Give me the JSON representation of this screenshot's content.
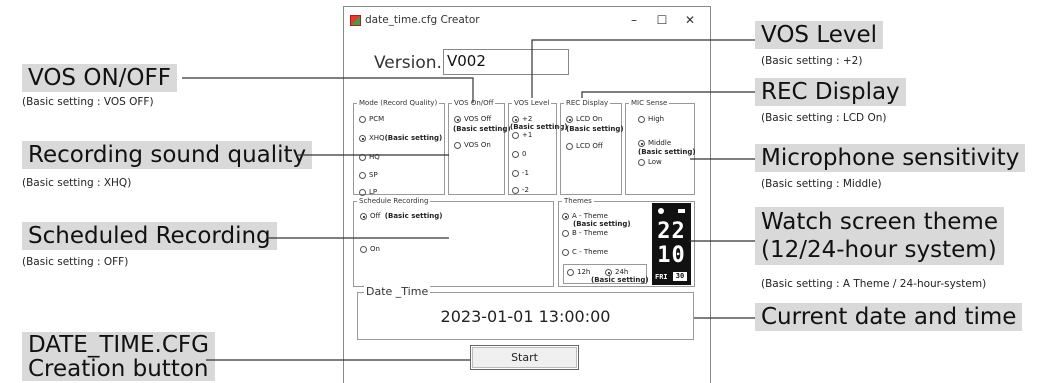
{
  "window": {
    "title": "date_time.cfg Creator",
    "controls": {
      "minimize": "–",
      "maximize": "☐",
      "close": "✕"
    }
  },
  "version": {
    "label": "Version.",
    "value": "V002"
  },
  "groups": {
    "mode": {
      "title": "Mode (Record Quality)",
      "options": [
        {
          "label": "PCM",
          "selected": false
        },
        {
          "label": "XHQ",
          "suffix": "(Basic setting)",
          "selected": true
        },
        {
          "label": "HQ",
          "selected": false
        },
        {
          "label": "SP",
          "selected": false
        },
        {
          "label": "LP",
          "selected": false
        }
      ]
    },
    "vos_onoff": {
      "title": "VOS On/Off",
      "options": [
        {
          "label": "VOS Off",
          "suffix": "(Basic setting)",
          "selected": true
        },
        {
          "label": "VOS On",
          "selected": false
        }
      ]
    },
    "vos_level": {
      "title": "VOS Level",
      "options": [
        {
          "label": "+2",
          "suffix": "(Basic setting)",
          "selected": true
        },
        {
          "label": "+1",
          "selected": false
        },
        {
          "label": "0",
          "selected": false
        },
        {
          "label": "-1",
          "selected": false
        },
        {
          "label": "-2",
          "selected": false
        }
      ]
    },
    "rec_display": {
      "title": "REC Display",
      "options": [
        {
          "label": "LCD On",
          "suffix": "(Basic setting)",
          "selected": true
        },
        {
          "label": "LCD Off",
          "selected": false
        }
      ]
    },
    "mic_sense": {
      "title": "MIC Sense",
      "options": [
        {
          "label": "High",
          "selected": false
        },
        {
          "label": "Middle",
          "suffix": "(Basic setting)",
          "selected": true
        },
        {
          "label": "Low",
          "selected": false
        }
      ]
    },
    "schedule": {
      "title": "Schedule Recording",
      "options": [
        {
          "label": "Off",
          "suffix": "(Basic setting)",
          "selected": true
        },
        {
          "label": "On",
          "selected": false
        }
      ]
    },
    "themes": {
      "title": "Themes",
      "options": [
        {
          "label": "A - Theme",
          "suffix": "(Basic setting)",
          "selected": true
        },
        {
          "label": "B - Theme",
          "selected": false
        },
        {
          "label": "C - Theme",
          "selected": false
        }
      ],
      "hour": [
        {
          "label": "12h",
          "selected": false
        },
        {
          "label": "24h",
          "suffix": "(Basic setting)",
          "selected": true
        }
      ],
      "watch": {
        "hours": "22",
        "minutes": "10",
        "day": "FRI",
        "date": "30"
      }
    }
  },
  "datetime": {
    "title": "Date _Time",
    "value": "2023-01-01 13:00:00"
  },
  "start_button": "Start",
  "callouts": {
    "vos_onoff": {
      "title": "VOS ON/OFF",
      "note": "(Basic setting : VOS OFF)"
    },
    "quality": {
      "title": "Recording sound quality",
      "note": "(Basic setting : XHQ)"
    },
    "scheduled": {
      "title": "Scheduled Recording",
      "note": "(Basic setting : OFF)"
    },
    "creation": {
      "line1": "DATE_TIME.CFG",
      "line2": "Creation button"
    },
    "vos_level": {
      "title": "VOS Level",
      "note": "(Basic setting : +2)"
    },
    "rec_display": {
      "title": "REC Display",
      "note": "(Basic setting : LCD On)"
    },
    "mic": {
      "title": "Microphone sensitivity",
      "note": "(Basic setting : Middle)"
    },
    "theme": {
      "line1": "Watch screen theme",
      "line2": "(12/24-hour system)",
      "note": "(Basic setting : A Theme / 24-hour-system)"
    },
    "current": {
      "title": "Current date and time"
    }
  },
  "colors": {
    "callout_bg": "#d9d9d9",
    "watch_bg": "#111111"
  }
}
